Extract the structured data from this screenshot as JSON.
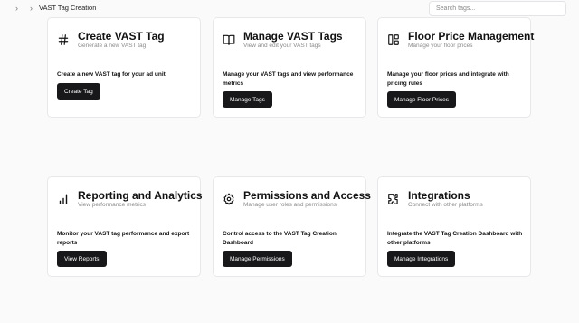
{
  "breadcrumb": {
    "current": "VAST Tag Creation"
  },
  "search": {
    "placeholder": "Search tags..."
  },
  "cards": [
    {
      "icon": "hash-icon",
      "title": "Create VAST Tag",
      "subtitle": "Generate a new VAST tag",
      "description": "Create a new VAST tag for your ad unit",
      "button": "Create Tag"
    },
    {
      "icon": "book-open-icon",
      "title": "Manage VAST Tags",
      "subtitle": "View and edit your VAST tags",
      "description": "Manage your VAST tags and view performance metrics",
      "button": "Manage Tags"
    },
    {
      "icon": "layout-panels-icon",
      "title": "Floor Price Management",
      "subtitle": "Manage your floor prices",
      "description": "Manage your floor prices and integrate with pricing rules",
      "button": "Manage Floor Prices"
    },
    {
      "icon": "bar-chart-icon",
      "title": "Reporting and Analytics",
      "subtitle": "View performance metrics",
      "description": "Monitor your VAST tag performance and export reports",
      "button": "View Reports"
    },
    {
      "icon": "gear-icon",
      "title": "Permissions and Access",
      "subtitle": "Manage user roles and permissions",
      "description": "Control access to the VAST Tag Creation Dashboard",
      "button": "Manage Permissions"
    },
    {
      "icon": "puzzle-icon",
      "title": "Integrations",
      "subtitle": "Connect with other platforms",
      "description": "Integrate the VAST Tag Creation Dashboard with other platforms",
      "button": "Manage Integrations"
    }
  ]
}
